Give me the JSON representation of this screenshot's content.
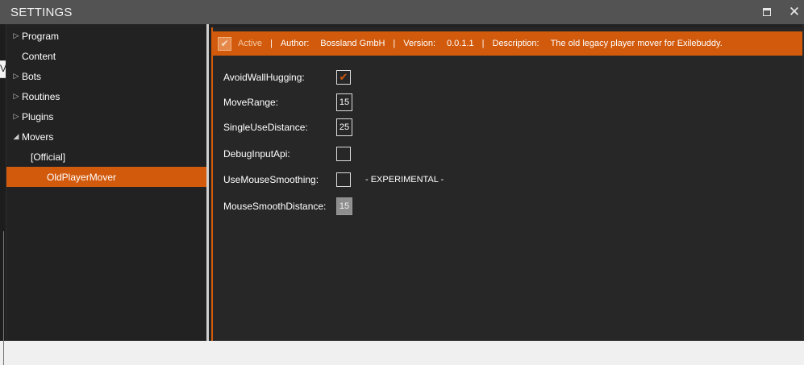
{
  "window": {
    "title": "SETTINGS",
    "maximize_icon": "maximize-icon",
    "close_glyph": "✕"
  },
  "left_strip_fragment": "V",
  "tree": {
    "items": [
      {
        "label": "Program",
        "expander": "▷",
        "indent": 0,
        "selected": false
      },
      {
        "label": "Content",
        "expander": "",
        "indent": 0,
        "selected": false
      },
      {
        "label": "Bots",
        "expander": "▷",
        "indent": 0,
        "selected": false
      },
      {
        "label": "Routines",
        "expander": "▷",
        "indent": 0,
        "selected": false
      },
      {
        "label": "Plugins",
        "expander": "▷",
        "indent": 0,
        "selected": false
      },
      {
        "label": "Movers",
        "expander": "◢",
        "indent": 0,
        "selected": false
      },
      {
        "label": "[Official]",
        "expander": "",
        "indent": 1,
        "selected": false
      },
      {
        "label": "OldPlayerMover",
        "expander": "",
        "indent": 2,
        "selected": true
      }
    ]
  },
  "header": {
    "active_checked": true,
    "check_glyph": "✔",
    "active_label": "Active",
    "separator": "|",
    "author_label": "Author:",
    "author_value": "Bossland GmbH",
    "version_label": "Version:",
    "version_value": "0.0.1.1",
    "description_label": "Description:",
    "description_value": "The old legacy player mover for Exilebuddy."
  },
  "settings": {
    "avoid_wall_hugging": {
      "label": "AvoidWallHugging:",
      "checked": true,
      "glyph": "✔"
    },
    "move_range": {
      "label": "MoveRange:",
      "value": "15"
    },
    "single_use_distance": {
      "label": "SingleUseDistance:",
      "value": "25"
    },
    "debug_input_api": {
      "label": "DebugInputApi:",
      "checked": false
    },
    "use_mouse_smoothing": {
      "label": "UseMouseSmoothing:",
      "checked": false,
      "note": "- EXPERIMENTAL -"
    },
    "mouse_smooth_distance": {
      "label": "MouseSmoothDistance:",
      "value": "15",
      "enabled": false
    }
  },
  "colors": {
    "accent": "#d25a0c",
    "titlebar": "#535353",
    "background": "#222222"
  }
}
